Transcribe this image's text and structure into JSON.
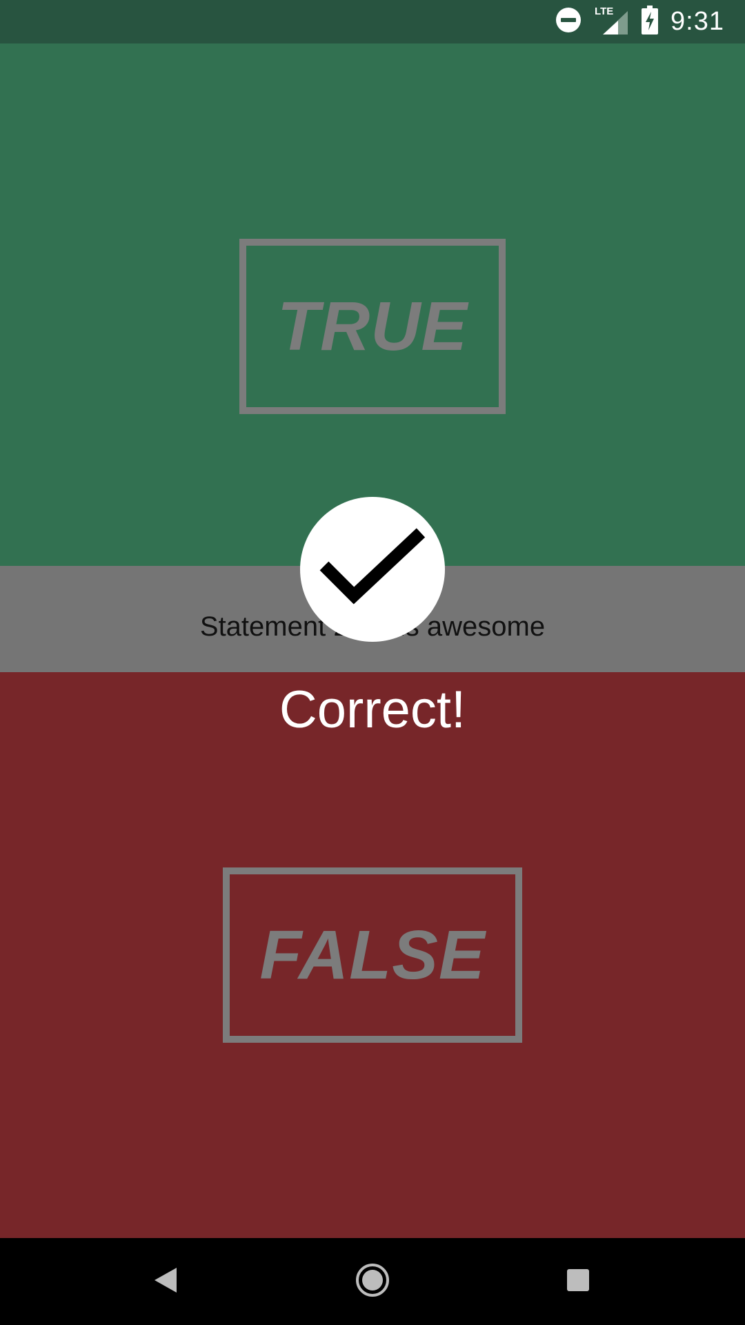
{
  "status_bar": {
    "time": "9:31",
    "network_label": "LTE",
    "icons": [
      "do-not-disturb-icon",
      "lte-signal-icon",
      "battery-charging-icon"
    ]
  },
  "quiz": {
    "true_label": "TRUE",
    "false_label": "FALSE",
    "statement": "Statement 2: … is awesome",
    "feedback": "Correct!",
    "result_icon": "checkmark-icon"
  },
  "nav_bar": {
    "icons": [
      "back-icon",
      "home-icon",
      "recents-icon"
    ]
  },
  "colors": {
    "status_bar": "#285440",
    "true_panel": "#327151",
    "statement_bar": "#757575",
    "false_panel": "#772629",
    "answer_outline": "#7c7c7c"
  }
}
